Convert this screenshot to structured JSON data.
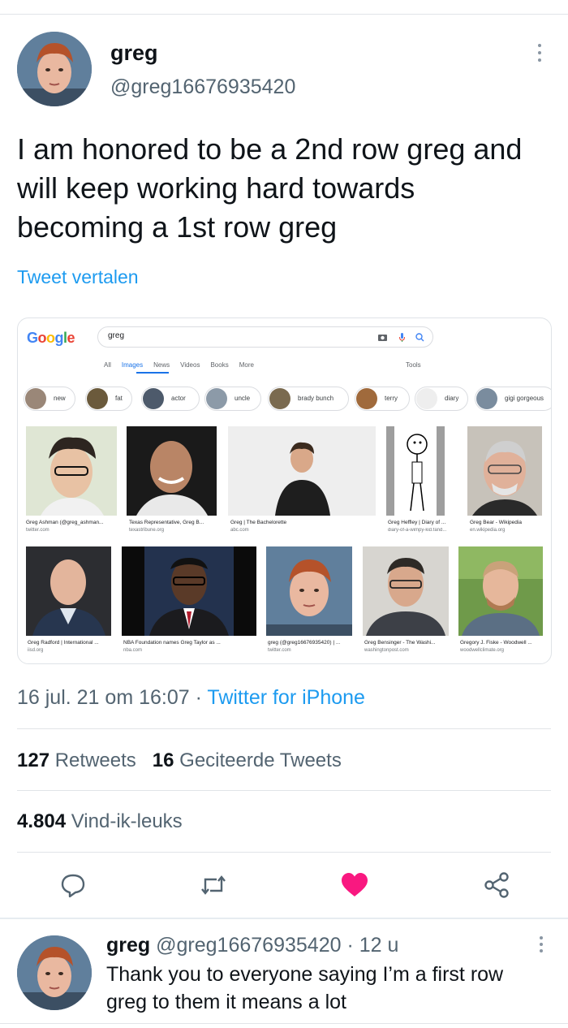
{
  "tweet": {
    "author_name": "greg",
    "author_handle": "@greg16676935420",
    "text": "I am honored to be a 2nd row greg and will keep working hard towards becoming a 1st row greg",
    "translate_label": "Tweet vertalen",
    "date": "16 jul. 21 om 16:07",
    "separator": " · ",
    "client": "Twitter for iPhone",
    "retweets_count": "127",
    "retweets_label": "Retweets",
    "quotes_count": "16",
    "quotes_label": "Geciteerde Tweets",
    "likes_count": "4.804",
    "likes_label": "Vind-ik-leuks",
    "like_color": "#f91880"
  },
  "embed": {
    "logo": [
      "G",
      "o",
      "o",
      "g",
      "l",
      "e"
    ],
    "query": "greg",
    "tabs": [
      "All",
      "Images",
      "News",
      "Videos",
      "Books",
      "More"
    ],
    "active_tab": "Images",
    "tools_label": "Tools",
    "chips": [
      "new",
      "fat",
      "actor",
      "uncle",
      "brady bunch",
      "terry",
      "diary",
      "gigi gorgeous"
    ],
    "results": [
      {
        "caption": "Greg Ashman (@greg_ashman...",
        "source": "twitter.com"
      },
      {
        "caption": "Texas Representative, Greg B...",
        "source": "texastribune.org"
      },
      {
        "caption": "Greg | The Bachelorette",
        "source": "abc.com"
      },
      {
        "caption": "Greg Heffley | Diary of ...",
        "source": "diary-of-a-wimpy-kid.fand..."
      },
      {
        "caption": "Greg Bear - Wikipedia",
        "source": "en.wikipedia.org"
      },
      {
        "caption": "Greg Radford | International ...",
        "source": "iisd.org"
      },
      {
        "caption": "NBA Foundation names Greg Taylor as ...",
        "source": "nba.com"
      },
      {
        "caption": "greg (@greg16676935420) | ...",
        "source": "twitter.com"
      },
      {
        "caption": "Greg Bensinger - The Washi...",
        "source": "washingtonpost.com"
      },
      {
        "caption": "Gregory J. Fiske - Woodwell ...",
        "source": "woodwellclimate.org"
      }
    ]
  },
  "reply": {
    "author_name": "greg",
    "author_handle": "@greg16676935420",
    "time": " · 12 u",
    "text": "Thank you to everyone saying I’m a first row greg to them it means a lot"
  }
}
